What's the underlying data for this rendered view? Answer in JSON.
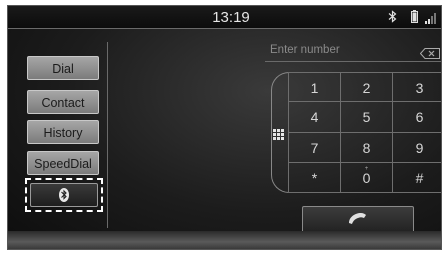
{
  "status_bar": {
    "time": "13:19",
    "icons": [
      "bluetooth-icon",
      "battery-icon",
      "signal-icon"
    ]
  },
  "sidebar": {
    "items": [
      {
        "label": "Dial"
      },
      {
        "label": "Contact"
      },
      {
        "label": "History"
      },
      {
        "label": "SpeedDial"
      }
    ],
    "bluetooth_button": {
      "icon": "bluetooth-icon",
      "selected": true
    }
  },
  "dialer": {
    "placeholder": "Enter number",
    "backspace_icon": "backspace-icon",
    "keypad_toggle_icon": "keypad-grid-icon",
    "keys": [
      {
        "label": "1"
      },
      {
        "label": "2"
      },
      {
        "label": "3"
      },
      {
        "label": "4"
      },
      {
        "label": "5"
      },
      {
        "label": "6"
      },
      {
        "label": "7"
      },
      {
        "label": "8"
      },
      {
        "label": "9"
      },
      {
        "label": "*"
      },
      {
        "label": "0",
        "sub": "+"
      },
      {
        "label": "#"
      }
    ],
    "call_icon": "phone-handset-icon"
  },
  "colors": {
    "background": "#1c1c1c",
    "button_gray": "#9a9a9a",
    "text_light": "#d6d6d6"
  }
}
